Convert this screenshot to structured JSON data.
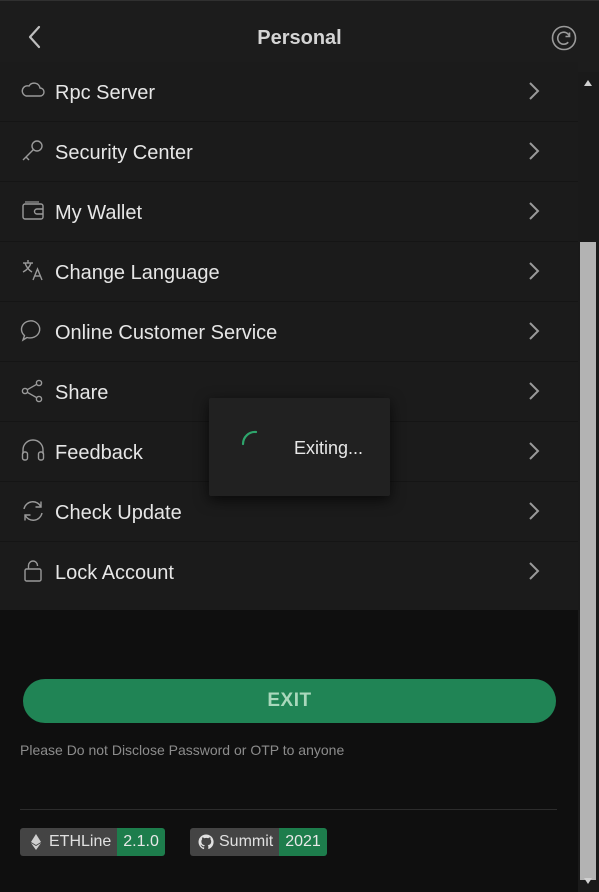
{
  "header": {
    "title": "Personal",
    "back_icon": "chevron-left-icon",
    "refresh_icon": "refresh-icon"
  },
  "menu": {
    "items": [
      {
        "label": "Rpc Server",
        "icon": "cloud-icon"
      },
      {
        "label": "Security Center",
        "icon": "key-icon"
      },
      {
        "label": "My Wallet",
        "icon": "wallet-icon"
      },
      {
        "label": "Change Language",
        "icon": "translate-icon"
      },
      {
        "label": "Online Customer Service",
        "icon": "chat-icon"
      },
      {
        "label": "Share",
        "icon": "share-icon"
      },
      {
        "label": "Feedback",
        "icon": "headset-icon"
      },
      {
        "label": "Check Update",
        "icon": "sync-icon"
      },
      {
        "label": "Lock Account",
        "icon": "lock-icon"
      }
    ]
  },
  "exit_button": {
    "label": "EXIT"
  },
  "notice": "Please Do not Disclose Password or OTP to anyone",
  "badges": [
    {
      "name": "ETHLine",
      "value": "2.1.0",
      "icon": "ethereum-icon"
    },
    {
      "name": "Summit",
      "value": "2021",
      "icon": "github-icon"
    }
  ],
  "toast": {
    "text": "Exiting..."
  },
  "colors": {
    "accent": "#208455",
    "background": "#0f0f0f",
    "panel": "#1b1b1b"
  }
}
